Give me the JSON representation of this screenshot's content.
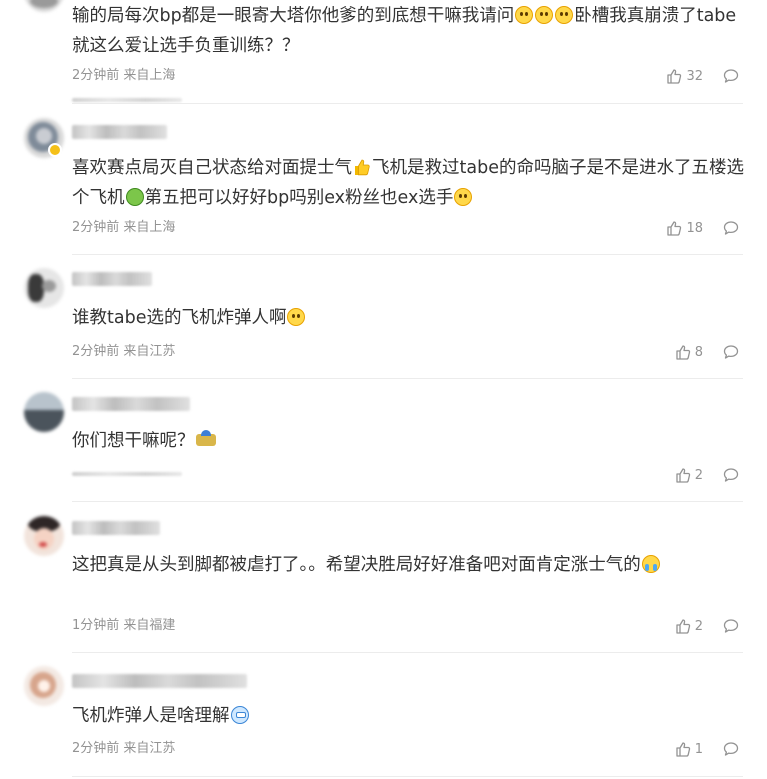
{
  "comments": [
    {
      "avatar_icon": "user-avatar-blurred",
      "text_segments": [
        "输的局每次bp都是一眼寄大塔你他爹的到底想干嘛我请问",
        "卧槽我真崩溃了tabe就这么爱让选手负重训练？？"
      ],
      "time": "2分钟前",
      "location": "来自上海",
      "likes": "32"
    },
    {
      "avatar_icon": "user-avatar-blurred",
      "text_segments": [
        "喜欢赛点局灭自己状态给对面提士气",
        "飞机是救过tabe的命吗脑子是不是进水了五楼选个飞机",
        "第五把可以好好bp吗别ex粉丝也ex选手"
      ],
      "time": "2分钟前",
      "location": "来自上海",
      "likes": "18"
    },
    {
      "avatar_icon": "user-avatar-blurred",
      "text_segments": [
        "谁教tabe选的飞机炸弹人啊"
      ],
      "time": "2分钟前",
      "location": "来自江苏",
      "likes": "8"
    },
    {
      "avatar_icon": "user-avatar-blurred",
      "text_segments": [
        "你们想干嘛呢？"
      ],
      "time": "",
      "location": "",
      "likes": "2"
    },
    {
      "avatar_icon": "user-avatar-blurred",
      "text_segments": [
        "这把真是从头到脚都被虐打了。。希望决胜局好好准备吧对面肯定涨士气的"
      ],
      "time": "1分钟前",
      "location": "来自福建",
      "likes": "2"
    },
    {
      "avatar_icon": "user-avatar-blurred",
      "text_segments": [
        "飞机炸弹人是啥理解"
      ],
      "time": "2分钟前",
      "location": "来自江苏",
      "likes": "1"
    }
  ],
  "icons": {
    "like": "thumbs-up-icon",
    "reply": "comment-bubble-icon"
  },
  "colors": {
    "text": "#333333",
    "meta": "#939393",
    "divider": "#ececec"
  }
}
